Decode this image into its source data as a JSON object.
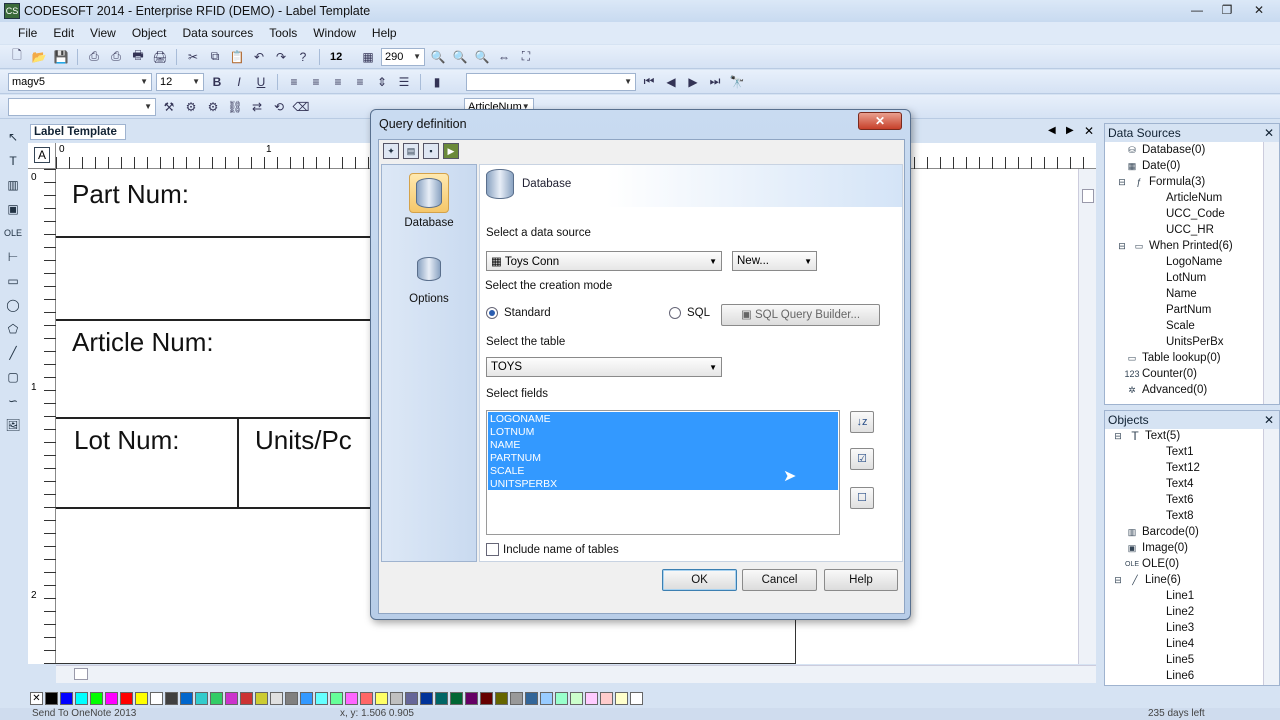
{
  "window": {
    "title": "CODESOFT 2014 - Enterprise RFID (DEMO) - Label Template",
    "app_icon": "CS",
    "minimize": "—",
    "restore": "❐",
    "close": "✕"
  },
  "menu": [
    "File",
    "Edit",
    "View",
    "Object",
    "Data sources",
    "Tools",
    "Window",
    "Help"
  ],
  "toolbar1": {
    "font_size_value": "12",
    "zoom_value": "290"
  },
  "toolbar2": {
    "font_name": "magv5",
    "font_size": "12",
    "bold": "B",
    "italic": "I",
    "underline": "U"
  },
  "toolbar3": {
    "field_combo": "ArticleNum"
  },
  "document": {
    "tab_title": "Label Template",
    "ruler_h": [
      "0",
      "1"
    ],
    "ruler_v": [
      "0",
      "1",
      "2"
    ],
    "label_texts": {
      "part_num": "Part Num:",
      "article_num": "Article Num:",
      "lot_num": "Lot Num:",
      "units": "Units/Pc"
    }
  },
  "data_sources": {
    "title": "Data Sources",
    "items": [
      {
        "label": "Database(0)",
        "icon": "database-icon"
      },
      {
        "label": "Date(0)",
        "icon": "date-icon"
      },
      {
        "label": "Formula(3)",
        "icon": "formula-icon"
      },
      {
        "label": "ArticleNum"
      },
      {
        "label": "UCC_Code"
      },
      {
        "label": "UCC_HR"
      },
      {
        "label": "When Printed(6)",
        "icon": "printed-icon"
      },
      {
        "label": "LogoName"
      },
      {
        "label": "LotNum"
      },
      {
        "label": "Name"
      },
      {
        "label": "PartNum"
      },
      {
        "label": "Scale"
      },
      {
        "label": "UnitsPerBx"
      },
      {
        "label": "Table lookup(0)",
        "icon": "table-icon"
      },
      {
        "label": "Counter(0)",
        "icon": "counter-icon"
      },
      {
        "label": "Advanced(0)",
        "icon": "advanced-icon"
      }
    ]
  },
  "objects": {
    "title": "Objects",
    "items": [
      {
        "label": "Text(5)"
      },
      {
        "label": "Text1"
      },
      {
        "label": "Text12"
      },
      {
        "label": "Text4"
      },
      {
        "label": "Text6"
      },
      {
        "label": "Text8"
      },
      {
        "label": "Barcode(0)"
      },
      {
        "label": "Image(0)"
      },
      {
        "label": "OLE(0)"
      },
      {
        "label": "Line(6)"
      },
      {
        "label": "Line1"
      },
      {
        "label": "Line2"
      },
      {
        "label": "Line3"
      },
      {
        "label": "Line4"
      },
      {
        "label": "Line5"
      },
      {
        "label": "Line6"
      }
    ]
  },
  "dialog": {
    "title": "Query definition",
    "close": "✕",
    "nav": [
      {
        "label": "Database",
        "icon": "database-icon",
        "selected": true
      },
      {
        "label": "Options",
        "icon": "options-icon",
        "selected": false
      }
    ],
    "header": "Database",
    "select_source_label": "Select a data source",
    "source_value": "Toys Conn",
    "new_button": "New...",
    "creation_mode_label": "Select the creation mode",
    "mode_standard": "Standard",
    "mode_sql": "SQL",
    "sql_builder": "SQL Query Builder...",
    "select_table_label": "Select the table",
    "table_value": "TOYS",
    "select_fields_label": "Select fields",
    "fields": [
      "LOGONAME",
      "LOTNUM",
      "NAME",
      "PARTNUM",
      "SCALE",
      "UNITSPERBX"
    ],
    "include_tables_label": "Include name of tables",
    "ok": "OK",
    "cancel": "Cancel",
    "help": "Help"
  },
  "palette_colors": [
    "#000000",
    "#0000ff",
    "#00ffff",
    "#00ff00",
    "#ff00ff",
    "#ff0000",
    "#ffff00",
    "#ffffff",
    "#404040",
    "#0066cc",
    "#33cccc",
    "#33cc66",
    "#cc33cc",
    "#cc3333",
    "#cccc33",
    "#e0e0e0",
    "#808080",
    "#3399ff",
    "#66ffff",
    "#66ff99",
    "#ff66ff",
    "#ff6666",
    "#ffff66",
    "#c0c0c0",
    "#666699",
    "#003399",
    "#006666",
    "#006633",
    "#660066",
    "#660000",
    "#666600",
    "#999999",
    "#336699",
    "#99ccff",
    "#99ffcc",
    "#ccffcc",
    "#ffccff",
    "#ffcccc",
    "#ffffcc",
    "#ffffff"
  ],
  "status": {
    "left": "Send To OneNote 2013",
    "mid": "x, y: 1.506 0.905",
    "right": "235 days left"
  }
}
